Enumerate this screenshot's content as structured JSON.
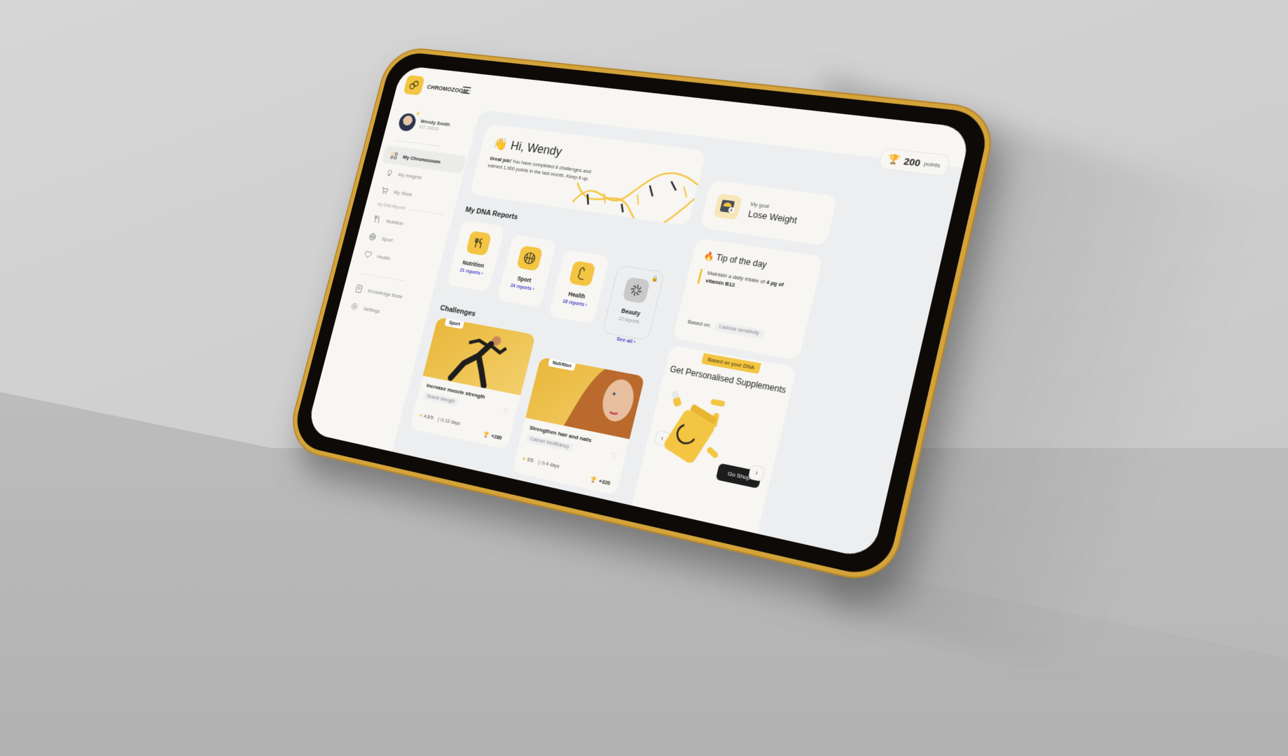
{
  "app": {
    "brand_name": "CHROMOZOOM"
  },
  "profile": {
    "name": "Wendy Smith",
    "kit": "KIT: 00003"
  },
  "sidebar": {
    "items": [
      {
        "label": "My Chromozoom",
        "icon": "grid-icon",
        "active": true
      },
      {
        "label": "My Insights",
        "icon": "lightbulb-icon",
        "active": false
      },
      {
        "label": "My Store",
        "icon": "cart-icon",
        "active": false
      }
    ],
    "section_label": "My DNA Reports",
    "report_items": [
      {
        "label": "Nutrition",
        "icon": "fork-knife-icon"
      },
      {
        "label": "Sport",
        "icon": "basketball-icon"
      },
      {
        "label": "Health",
        "icon": "heart-icon"
      }
    ],
    "footer_items": [
      {
        "label": "Knowledge Base",
        "icon": "book-icon"
      },
      {
        "label": "Settings",
        "icon": "gear-icon"
      }
    ]
  },
  "header": {
    "points_value": "200",
    "points_unit": "points"
  },
  "greeting": {
    "emoji": "👋",
    "title": "Hi, Wendy",
    "message_bold": "Great job!",
    "message": " You have completed 8 challenges and earned 1,900 points in the last month. Keep it up."
  },
  "goal": {
    "label": "My goal",
    "value": "Lose Weight"
  },
  "tip": {
    "emoji": "🔥",
    "title": "Tip of the day",
    "text_prefix": "Maintain a daily intake of ",
    "text_bold": "4 µg of vitamin B12",
    "text_suffix": ".",
    "based_on_label": "Based on:",
    "based_on_value": "Lactose sensitivity"
  },
  "dna_reports": {
    "title": "My DNA Reports",
    "items": [
      {
        "name": "Nutrition",
        "count": "21 reports",
        "locked": false
      },
      {
        "name": "Sport",
        "count": "24 reports",
        "locked": false
      },
      {
        "name": "Health",
        "count": "18 reports",
        "locked": false
      },
      {
        "name": "Beauty",
        "count": "12 reports",
        "locked": true
      }
    ]
  },
  "challenges": {
    "title": "Challenges",
    "see_all": "See all",
    "items": [
      {
        "tag": "Sport",
        "title": "Increase muscle strength",
        "chip": "Muscle strength",
        "rating": "4,8/5",
        "duration": "12 days",
        "points": "+280"
      },
      {
        "tag": "Nutrition",
        "title": "Strengthen hair and nails",
        "chip": "Calcium insufficiency",
        "rating": "5/5",
        "duration": "4 days",
        "points": "+320"
      }
    ]
  },
  "supplements": {
    "badge": "Based on your DNA",
    "title": "Get Personalised Supplements",
    "button": "Go Shop"
  },
  "colors": {
    "accent": "#f4c542",
    "link": "#4b45c6",
    "dark_button": "#1d1d1d"
  }
}
